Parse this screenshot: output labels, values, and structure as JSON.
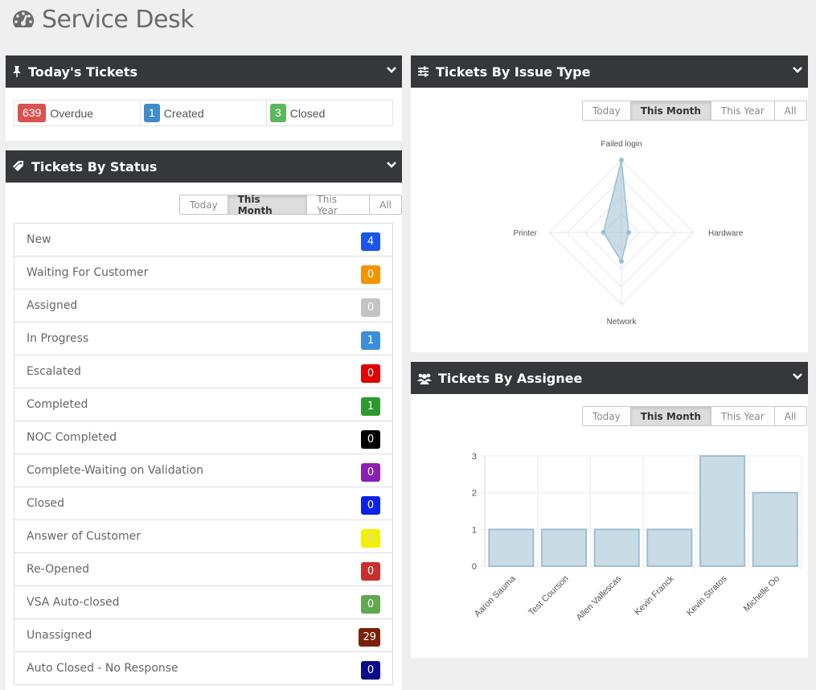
{
  "page": {
    "title": "Service Desk",
    "icon": "dashboard-icon"
  },
  "todays_tickets": {
    "title": "Today's Tickets",
    "icon": "pin-icon",
    "items": [
      {
        "count": "639",
        "label": "Overdue",
        "color": "#d9534f"
      },
      {
        "count": "1",
        "label": "Created",
        "color": "#428bca"
      },
      {
        "count": "3",
        "label": "Closed",
        "color": "#5cb85c"
      }
    ]
  },
  "range_options": [
    "Today",
    "This Month",
    "This Year",
    "All"
  ],
  "range_selected": "This Month",
  "tickets_by_status": {
    "title": "Tickets By Status",
    "icon": "tag-icon",
    "items": [
      {
        "label": "New",
        "count": "4",
        "color": "#1a56e8",
        "text": "#fff"
      },
      {
        "label": "Waiting For Customer",
        "count": "0",
        "color": "#f39400",
        "text": "#fff"
      },
      {
        "label": "Assigned",
        "count": "0",
        "color": "#c4c4c4",
        "text": "#fff"
      },
      {
        "label": "In Progress",
        "count": "1",
        "color": "#3a8fd8",
        "text": "#fff"
      },
      {
        "label": "Escalated",
        "count": "0",
        "color": "#e00000",
        "text": "#fff"
      },
      {
        "label": "Completed",
        "count": "1",
        "color": "#2e9a2e",
        "text": "#fff"
      },
      {
        "label": "NOC Completed",
        "count": "0",
        "color": "#000000",
        "text": "#fff"
      },
      {
        "label": "Complete-Waiting on Validation",
        "count": "0",
        "color": "#8a1fb0",
        "text": "#fff"
      },
      {
        "label": "Closed",
        "count": "0",
        "color": "#0b22e6",
        "text": "#fff"
      },
      {
        "label": "Answer of Customer",
        "count": "0",
        "color": "#f2f200",
        "text": "#d8d8d8"
      },
      {
        "label": "Re-Opened",
        "count": "0",
        "color": "#c9302c",
        "text": "#fff"
      },
      {
        "label": "VSA Auto-closed",
        "count": "0",
        "color": "#62a850",
        "text": "#fff"
      },
      {
        "label": "Unassigned",
        "count": "29",
        "color": "#7a1f08",
        "text": "#fff"
      },
      {
        "label": "Auto Closed - No Response",
        "count": "0",
        "color": "#0a0a8a",
        "text": "#fff"
      }
    ]
  },
  "tickets_by_issue_type": {
    "title": "Tickets By Issue Type",
    "icon": "sliders-icon"
  },
  "tickets_by_assignee": {
    "title": "Tickets By Assignee",
    "icon": "users-icon"
  },
  "chart_data": [
    {
      "type": "radar",
      "axes": [
        "Failed login",
        "Hardware",
        "Network",
        "Printer"
      ],
      "values": [
        4,
        0.4,
        1.6,
        1
      ],
      "max": 4,
      "color": "#9fbfd2"
    },
    {
      "type": "bar",
      "categories": [
        "Aaron Sauma",
        "Test Courson",
        "Allen Vallescas",
        "Kevin Franck",
        "Kevin Stratos",
        "Michelle Oo"
      ],
      "values": [
        1,
        1,
        1,
        1,
        3,
        2
      ],
      "ylim": [
        0,
        3
      ],
      "yticks": [
        0,
        1,
        2,
        3
      ],
      "color": "#c9dbe5",
      "border": "#9fbfd2"
    }
  ]
}
